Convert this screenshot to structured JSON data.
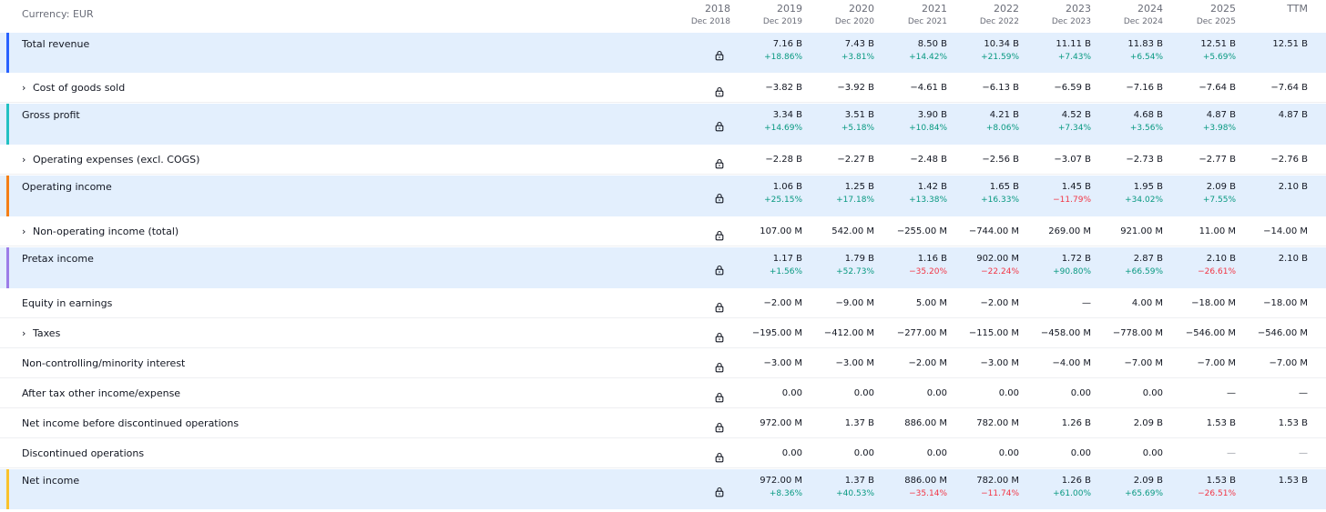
{
  "currency_label": "Currency: EUR",
  "colors": {
    "accent_blue": "#2962ff",
    "accent_teal": "#22c1c3",
    "accent_orange": "#f57f17",
    "accent_purple": "#9c7ce8",
    "accent_yellow": "#f9c22b",
    "positive": "#089981",
    "negative": "#f23645",
    "highlight_bg": "#e3effd"
  },
  "columns": [
    {
      "year": "2018",
      "period": "Dec 2018"
    },
    {
      "year": "2019",
      "period": "Dec 2019"
    },
    {
      "year": "2020",
      "period": "Dec 2020"
    },
    {
      "year": "2021",
      "period": "Dec 2021"
    },
    {
      "year": "2022",
      "period": "Dec 2022"
    },
    {
      "year": "2023",
      "period": "Dec 2023"
    },
    {
      "year": "2024",
      "period": "Dec 2024"
    },
    {
      "year": "2025",
      "period": "Dec 2025"
    },
    {
      "year": "TTM",
      "period": ""
    }
  ],
  "rows": [
    {
      "label": "Total revenue",
      "highlight": true,
      "accent": "#2962ff",
      "expandable": false,
      "locked_2018": true,
      "values": [
        "7.16 B",
        "7.43 B",
        "8.50 B",
        "10.34 B",
        "11.11 B",
        "11.83 B",
        "12.51 B",
        "12.51 B"
      ],
      "changes": [
        "+18.86%",
        "+3.81%",
        "+14.42%",
        "+21.59%",
        "+7.43%",
        "+6.54%",
        "+5.69%",
        ""
      ]
    },
    {
      "label": "Cost of goods sold",
      "highlight": false,
      "expandable": true,
      "locked_2018": true,
      "values": [
        "−3.82 B",
        "−3.92 B",
        "−4.61 B",
        "−6.13 B",
        "−6.59 B",
        "−7.16 B",
        "−7.64 B",
        "−7.64 B"
      ]
    },
    {
      "label": "Gross profit",
      "highlight": true,
      "accent": "#22c1c3",
      "expandable": false,
      "locked_2018": true,
      "values": [
        "3.34 B",
        "3.51 B",
        "3.90 B",
        "4.21 B",
        "4.52 B",
        "4.68 B",
        "4.87 B",
        "4.87 B"
      ],
      "changes": [
        "+14.69%",
        "+5.18%",
        "+10.84%",
        "+8.06%",
        "+7.34%",
        "+3.56%",
        "+3.98%",
        ""
      ]
    },
    {
      "label": "Operating expenses (excl. COGS)",
      "highlight": false,
      "expandable": true,
      "locked_2018": true,
      "values": [
        "−2.28 B",
        "−2.27 B",
        "−2.48 B",
        "−2.56 B",
        "−3.07 B",
        "−2.73 B",
        "−2.77 B",
        "−2.76 B"
      ]
    },
    {
      "label": "Operating income",
      "highlight": true,
      "accent": "#f57f17",
      "expandable": false,
      "locked_2018": true,
      "values": [
        "1.06 B",
        "1.25 B",
        "1.42 B",
        "1.65 B",
        "1.45 B",
        "1.95 B",
        "2.09 B",
        "2.10 B"
      ],
      "changes": [
        "+25.15%",
        "+17.18%",
        "+13.38%",
        "+16.33%",
        "−11.79%",
        "+34.02%",
        "+7.55%",
        ""
      ]
    },
    {
      "label": "Non-operating income (total)",
      "highlight": false,
      "expandable": true,
      "locked_2018": true,
      "values": [
        "107.00 M",
        "542.00 M",
        "−255.00 M",
        "−744.00 M",
        "269.00 M",
        "921.00 M",
        "11.00 M",
        "−14.00 M"
      ]
    },
    {
      "label": "Pretax income",
      "highlight": true,
      "accent": "#9c7ce8",
      "expandable": false,
      "locked_2018": true,
      "values": [
        "1.17 B",
        "1.79 B",
        "1.16 B",
        "902.00 M",
        "1.72 B",
        "2.87 B",
        "2.10 B",
        "2.10 B"
      ],
      "changes": [
        "+1.56%",
        "+52.73%",
        "−35.20%",
        "−22.24%",
        "+90.80%",
        "+66.59%",
        "−26.61%",
        ""
      ]
    },
    {
      "label": "Equity in earnings",
      "highlight": false,
      "expandable": false,
      "locked_2018": true,
      "values": [
        "−2.00 M",
        "−9.00 M",
        "5.00 M",
        "−2.00 M",
        "—",
        "4.00 M",
        "−18.00 M",
        "−18.00 M"
      ]
    },
    {
      "label": "Taxes",
      "highlight": false,
      "expandable": true,
      "locked_2018": true,
      "values": [
        "−195.00 M",
        "−412.00 M",
        "−277.00 M",
        "−115.00 M",
        "−458.00 M",
        "−778.00 M",
        "−546.00 M",
        "−546.00 M"
      ]
    },
    {
      "label": "Non-controlling/minority interest",
      "highlight": false,
      "expandable": false,
      "locked_2018": true,
      "values": [
        "−3.00 M",
        "−3.00 M",
        "−2.00 M",
        "−3.00 M",
        "−4.00 M",
        "−7.00 M",
        "−7.00 M",
        "−7.00 M"
      ]
    },
    {
      "label": "After tax other income/expense",
      "highlight": false,
      "expandable": false,
      "locked_2018": true,
      "values": [
        "0.00",
        "0.00",
        "0.00",
        "0.00",
        "0.00",
        "0.00",
        "—",
        "—"
      ]
    },
    {
      "label": "Net income before discontinued operations",
      "highlight": false,
      "expandable": false,
      "locked_2018": true,
      "values": [
        "972.00 M",
        "1.37 B",
        "886.00 M",
        "782.00 M",
        "1.26 B",
        "2.09 B",
        "1.53 B",
        "1.53 B"
      ]
    },
    {
      "label": "Discontinued operations",
      "highlight": false,
      "expandable": false,
      "locked_2018": true,
      "values": [
        "0.00",
        "0.00",
        "0.00",
        "0.00",
        "0.00",
        "0.00",
        "—",
        "—"
      ]
    },
    {
      "label": "Net income",
      "highlight": true,
      "accent": "#f9c22b",
      "expandable": false,
      "locked_2018": true,
      "values": [
        "972.00 M",
        "1.37 B",
        "886.00 M",
        "782.00 M",
        "1.26 B",
        "2.09 B",
        "1.53 B",
        "1.53 B"
      ],
      "changes": [
        "+8.36%",
        "+40.53%",
        "−35.14%",
        "−11.74%",
        "+61.00%",
        "+65.69%",
        "−26.51%",
        ""
      ]
    }
  ]
}
